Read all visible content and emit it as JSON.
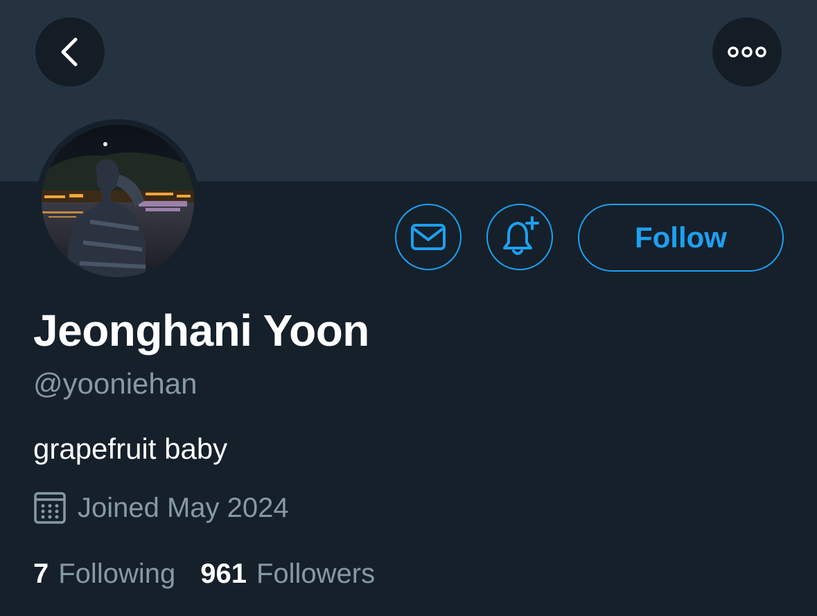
{
  "header": {
    "back_icon": "chevron-left-icon",
    "more_icon": "more-horizontal-icon"
  },
  "colors": {
    "background": "#15202b",
    "banner": "#253341",
    "accent": "#1da1f2",
    "secondary_text": "#8899a6"
  },
  "actions": {
    "message_icon": "envelope-icon",
    "notify_icon": "bell-plus-icon",
    "follow_label": "Follow"
  },
  "profile": {
    "name": "Jeonghani Yoon",
    "handle": "@yooniehan",
    "bio": "grapefruit baby",
    "joined": "Joined May 2024",
    "joined_icon": "calendar-icon"
  },
  "stats": {
    "following_count": "7",
    "following_label": "Following",
    "followers_count": "961",
    "followers_label": "Followers"
  }
}
